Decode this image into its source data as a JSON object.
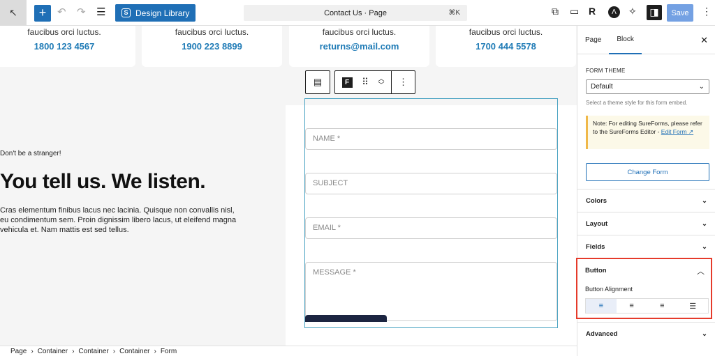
{
  "topbar": {
    "command_title": "Contact Us · Page",
    "command_shortcut": "⌘K",
    "design_library_label": "Design Library",
    "save_label": "Save"
  },
  "contact_cards": [
    {
      "text": "faucibus orci luctus.",
      "value": "1800 123 4567"
    },
    {
      "text": "faucibus orci luctus.",
      "value": "1900 223 8899"
    },
    {
      "text": "faucibus orci luctus.",
      "value": "returns@mail.com"
    },
    {
      "text": "faucibus orci luctus.",
      "value": "1700 444 5578"
    }
  ],
  "content": {
    "tagline": "Don't be a stranger!",
    "headline": "You tell us. We listen.",
    "paragraph": "Cras elementum finibus lacus nec lacinia. Quisque non convallis nisl, eu condimentum sem. Proin dignissim libero lacus, ut eleifend magna vehicula et. Nam mattis est sed tellus."
  },
  "form": {
    "name_placeholder": "NAME *",
    "subject_placeholder": "SUBJECT",
    "email_placeholder": "EMAIL *",
    "message_placeholder": "MESSAGE *"
  },
  "breadcrumb": [
    "Page",
    "Container",
    "Container",
    "Container",
    "Form"
  ],
  "breadcrumb_sep": "›",
  "sidebar": {
    "tabs": [
      "Page",
      "Block"
    ],
    "form_theme_label": "FORM THEME",
    "form_theme_value": "Default",
    "form_theme_help": "Select a theme style for this form embed.",
    "note_text": "Note: For editing SureForms, please refer to the SureForms Editor -",
    "note_link": "Edit Form ↗",
    "change_form_label": "Change Form",
    "panels": [
      "Colors",
      "Layout",
      "Fields"
    ],
    "button_panel_title": "Button",
    "button_alignment_label": "Button Alignment",
    "advanced_label": "Advanced"
  }
}
